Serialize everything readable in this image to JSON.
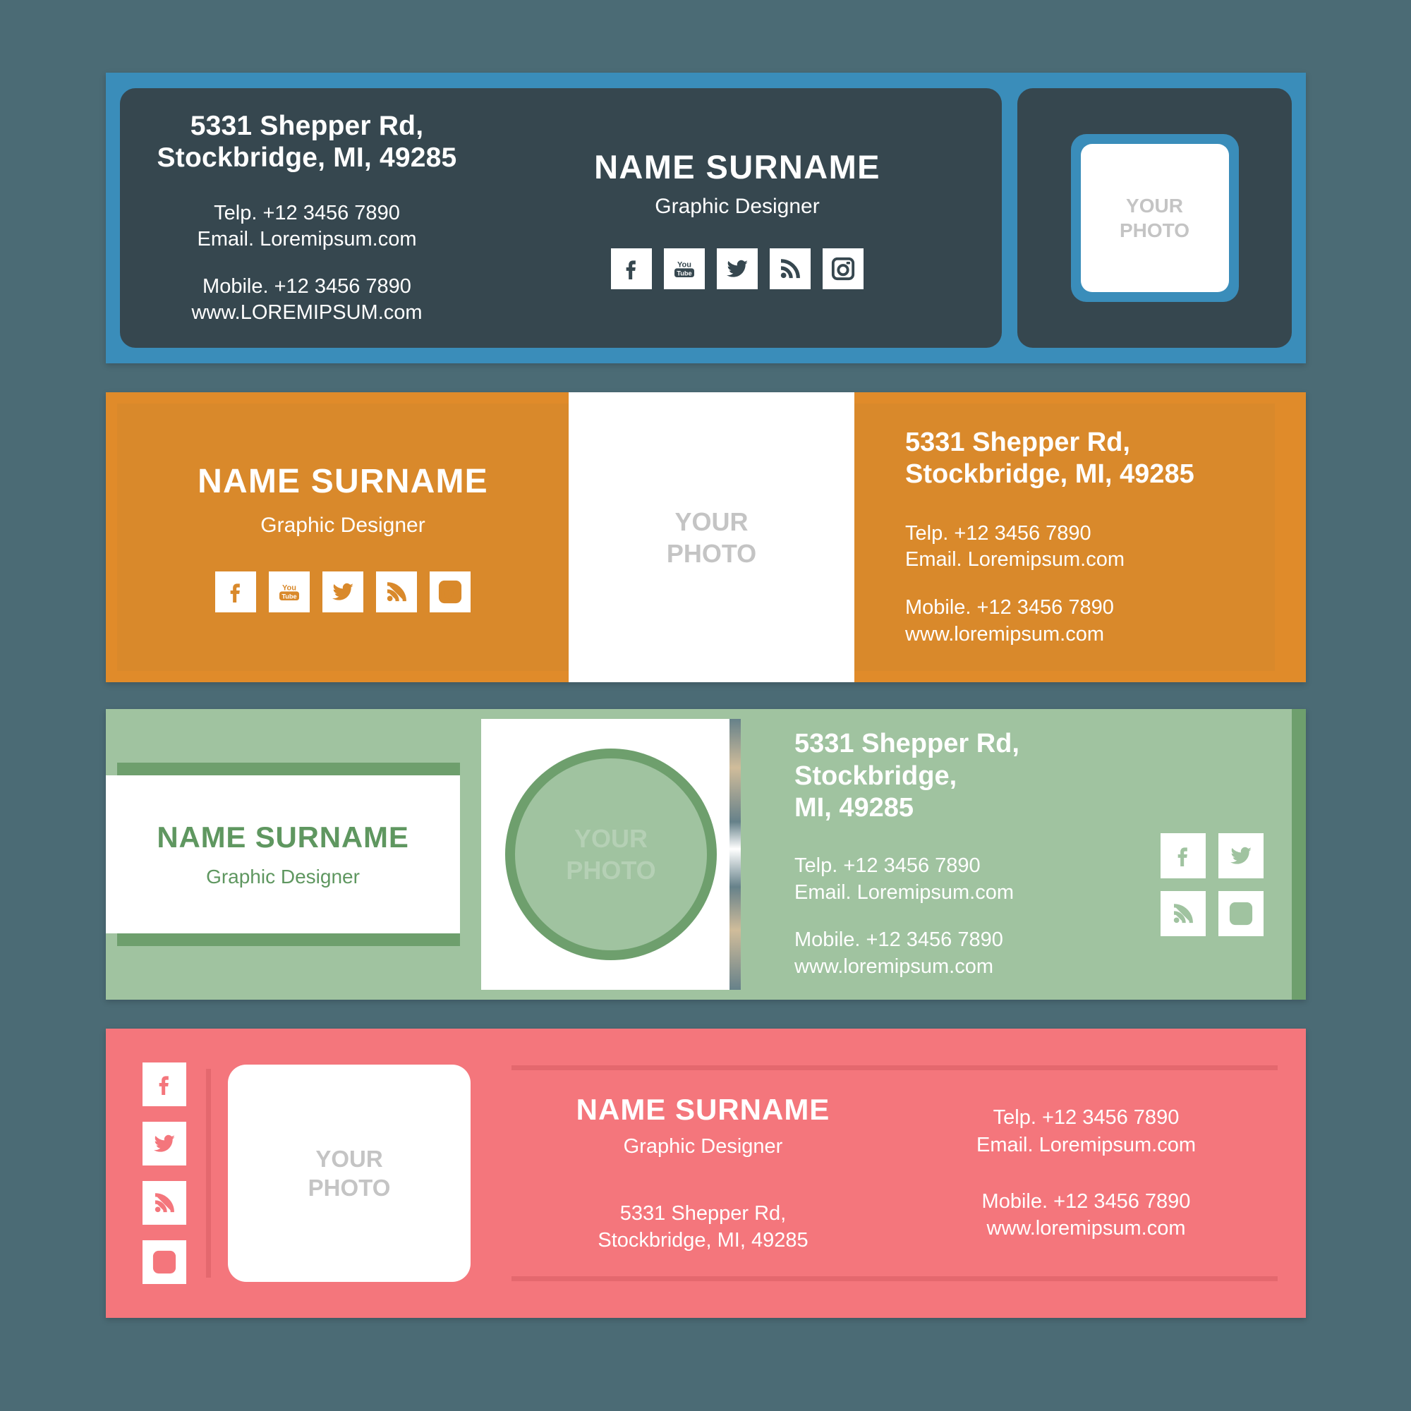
{
  "palette": {
    "page_background": "#4b6b75",
    "card1_border": "#3a8dba",
    "card1_panel": "#36474f",
    "card2_bg": "#d9892b",
    "card2_border": "#e08b2a",
    "card3_bg": "#a0c3a0",
    "card3_accent": "#6e9f6d",
    "card4_bg": "#f4767c",
    "card4_rule": "#e4686e",
    "photo_placeholder_text": "#c4c4c4"
  },
  "person": {
    "name": "NAME SURNAME",
    "role": "Graphic Designer"
  },
  "photo": {
    "placeholder": "YOUR\nPHOTO"
  },
  "contact": {
    "address_strong": "5331 Shepper Rd,\nStockbridge, MI, 49285",
    "address_strong_green": "5331 Shepper Rd,  Stockbridge,\nMI, 49285",
    "address_plain": "5331 Shepper Rd,\nStockbridge, MI, 49285",
    "telephone": "Telp. +12 3456 7890",
    "email": "Email. Loremipsum.com",
    "mobile": "Mobile. +12 3456 7890",
    "website": "www.loremipsum.com",
    "website_caps": "www.LOREMIPSUM.com",
    "block_tel_email": "Telp. +12 3456 7890\nEmail. Loremipsum.com",
    "block_mobile_web_caps": "Mobile. +12 3456 7890\nwww.LOREMIPSUM.com",
    "block_mobile_web": "Mobile. +12 3456 7890\nwww.loremipsum.com"
  },
  "social": {
    "full_set": [
      "facebook",
      "youtube",
      "twitter",
      "rss",
      "instagram"
    ],
    "quad_set": [
      "facebook",
      "twitter",
      "rss",
      "instagram"
    ],
    "labels": {
      "facebook": "Facebook",
      "youtube": "YouTube",
      "twitter": "Twitter",
      "rss": "RSS",
      "instagram": "Instagram"
    }
  },
  "cards": [
    {
      "id": "card-dark",
      "theme": "dark-blue",
      "layout": "address-left / identity-center / photo-right"
    },
    {
      "id": "card-orange",
      "theme": "orange",
      "layout": "identity-left / photo-center / address-right"
    },
    {
      "id": "card-green",
      "theme": "green",
      "layout": "identity-left / circle-photo-center / address-right"
    },
    {
      "id": "card-pink",
      "theme": "pink",
      "layout": "socials-left / photo / identity / address"
    }
  ]
}
